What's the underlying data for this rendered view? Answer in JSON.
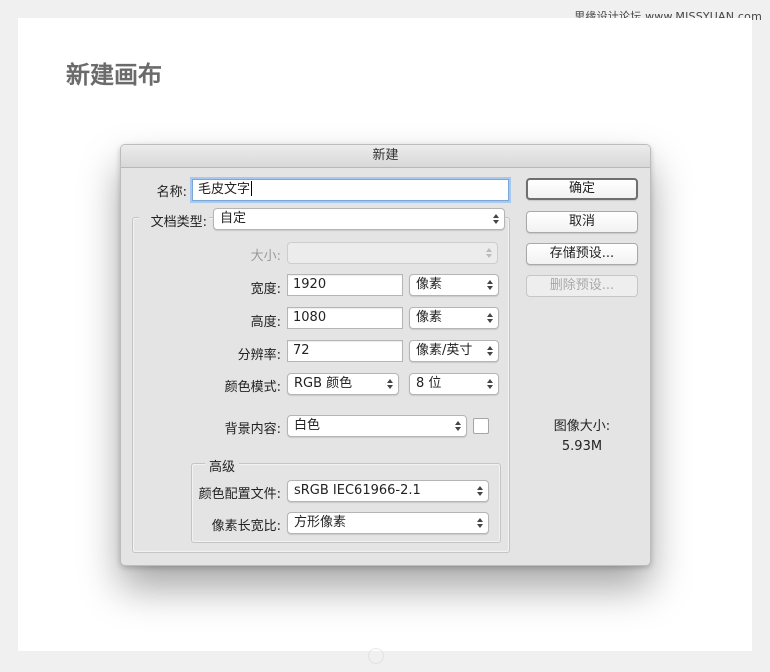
{
  "watermark": "思缘设计论坛 www.MISSYUAN.com",
  "page_heading": "新建画布",
  "dialog": {
    "title": "新建",
    "name_label": "名称:",
    "name_value": "毛皮文字",
    "doc_type_label": "文档类型:",
    "doc_type_value": "自定",
    "size_label": "大小:",
    "size_value": "",
    "width_label": "宽度:",
    "width_value": "1920",
    "width_unit": "像素",
    "height_label": "高度:",
    "height_value": "1080",
    "height_unit": "像素",
    "resolution_label": "分辨率:",
    "resolution_value": "72",
    "resolution_unit": "像素/英寸",
    "color_mode_label": "颜色模式:",
    "color_mode_value": "RGB 颜色",
    "bit_depth_value": "8 位",
    "background_label": "背景内容:",
    "background_value": "白色",
    "advanced_label": "高级",
    "color_profile_label": "颜色配置文件:",
    "color_profile_value": "sRGB IEC61966-2.1",
    "pixel_aspect_label": "像素长宽比:",
    "pixel_aspect_value": "方形像素",
    "buttons": {
      "ok": "确定",
      "cancel": "取消",
      "save_preset": "存储预设...",
      "delete_preset": "删除预设..."
    },
    "image_size_label": "图像大小:",
    "image_size_value": "5.93M"
  }
}
